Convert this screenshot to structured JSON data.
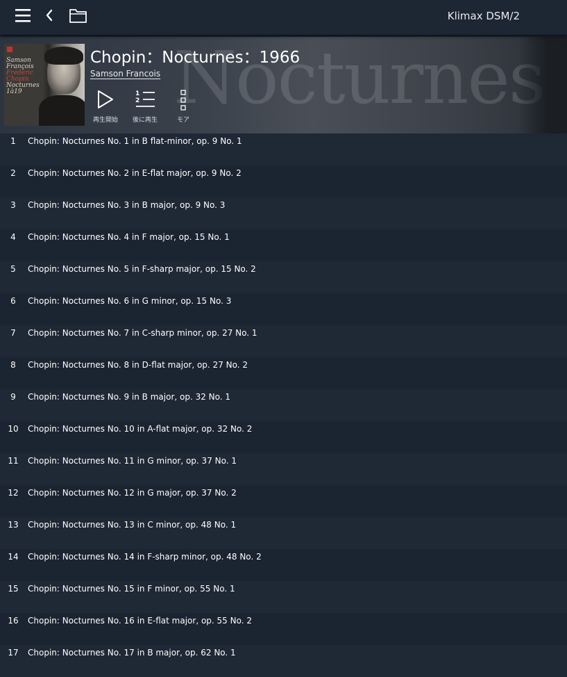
{
  "topbar": {
    "device_name": "Klimax DSM/2",
    "icons": [
      "menu-icon",
      "back-icon",
      "folder-icon"
    ]
  },
  "album": {
    "title": "Chopin：Nocturnes：1966",
    "artist": "Samson Francois",
    "background_word": "Nocturnes",
    "cover_text": {
      "line1": "Samson",
      "line2": "François",
      "line3": "Frédéric",
      "line4": "Chopin",
      "line5": "Nocturnes",
      "line6": "1à19"
    }
  },
  "actions": {
    "play_label": "再生開始",
    "queue_label": "後に再生",
    "more_label": "モア"
  },
  "tracks": [
    {
      "num": "1",
      "title": "Chopin: Nocturnes No. 1 in B flat-minor, op. 9 No. 1"
    },
    {
      "num": "2",
      "title": "Chopin: Nocturnes No. 2 in E-flat major, op. 9 No. 2"
    },
    {
      "num": "3",
      "title": "Chopin: Nocturnes No. 3 in B major, op. 9 No. 3"
    },
    {
      "num": "4",
      "title": "Chopin: Nocturnes No. 4 in F major, op. 15 No. 1"
    },
    {
      "num": "5",
      "title": "Chopin: Nocturnes No. 5 in F-sharp major, op. 15 No. 2"
    },
    {
      "num": "6",
      "title": "Chopin: Nocturnes No. 6 in G minor, op. 15 No. 3"
    },
    {
      "num": "7",
      "title": "Chopin: Nocturnes No. 7 in C-sharp minor, op. 27 No. 1"
    },
    {
      "num": "8",
      "title": "Chopin: Nocturnes No. 8 in D-flat major, op. 27 No. 2"
    },
    {
      "num": "9",
      "title": "Chopin: Nocturnes No. 9 in B major, op. 32 No. 1"
    },
    {
      "num": "10",
      "title": "Chopin: Nocturnes No. 10 in A-flat major, op. 32 No. 2"
    },
    {
      "num": "11",
      "title": "Chopin: Nocturnes No. 11 in G minor, op. 37 No. 1"
    },
    {
      "num": "12",
      "title": "Chopin: Nocturnes No. 12 in G major, op. 37 No. 2"
    },
    {
      "num": "13",
      "title": "Chopin: Nocturnes No. 13 in C minor, op. 48 No. 1"
    },
    {
      "num": "14",
      "title": "Chopin: Nocturnes No. 14 in F-sharp minor, op. 48 No. 2"
    },
    {
      "num": "15",
      "title": "Chopin: Nocturnes No. 15 in F minor, op. 55 No. 1"
    },
    {
      "num": "16",
      "title": "Chopin: Nocturnes No. 16 in E-flat major, op. 55 No. 2"
    },
    {
      "num": "17",
      "title": "Chopin: Nocturnes No. 17 in B major, op. 62 No. 1"
    }
  ],
  "colors": {
    "background": "#1b2431",
    "row_alt": "#1f2835",
    "topbar": "#1d2633",
    "text": "#ffffff"
  }
}
